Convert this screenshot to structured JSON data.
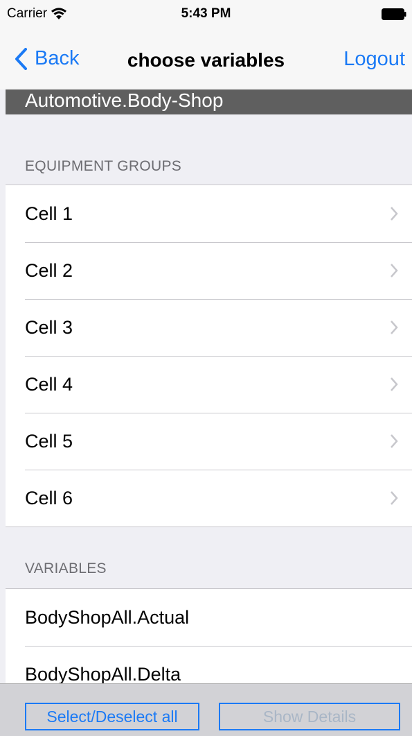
{
  "status": {
    "carrier": "Carrier",
    "time": "5:43 PM"
  },
  "nav": {
    "back_label": "Back",
    "title": "choose variables",
    "logout_label": "Logout"
  },
  "path_banner": "Automotive.Body-Shop",
  "equipment_groups": {
    "header": "EQUIPMENT GROUPS",
    "items": [
      {
        "label": "Cell 1"
      },
      {
        "label": "Cell 2"
      },
      {
        "label": "Cell 3"
      },
      {
        "label": "Cell 4"
      },
      {
        "label": "Cell 5"
      },
      {
        "label": "Cell 6"
      }
    ]
  },
  "variables": {
    "header": "VARIABLES",
    "items": [
      {
        "label": "BodyShopAll.Actual"
      },
      {
        "label": "BodyShopAll.Delta"
      }
    ]
  },
  "toolbar": {
    "select_all_label": "Select/Deselect all",
    "show_details_label": "Show Details",
    "show_details_enabled": false
  },
  "colors": {
    "accent": "#1b7af5",
    "banner": "#5f5f5f",
    "background": "#efeff4"
  }
}
